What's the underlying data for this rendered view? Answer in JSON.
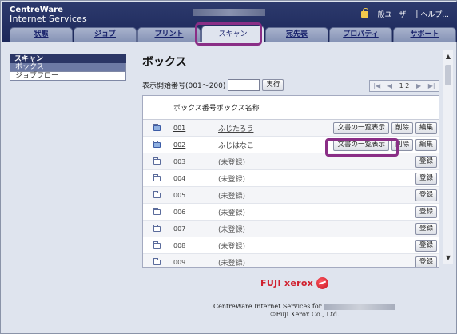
{
  "header": {
    "brand_line1": "CentreWare",
    "brand_line2": "Internet Services",
    "user_label": "一般ユーザー",
    "help_label": "ヘルプ..."
  },
  "tabs": [
    {
      "label": "状態"
    },
    {
      "label": "ジョブ"
    },
    {
      "label": "プリント"
    },
    {
      "label": "スキャン"
    },
    {
      "label": "宛先表"
    },
    {
      "label": "プロパティ"
    },
    {
      "label": "サポート"
    }
  ],
  "sidebar": {
    "title": "スキャン",
    "items": [
      {
        "label": "ボックス"
      },
      {
        "label": "ジョブフロー"
      }
    ]
  },
  "main": {
    "title": "ボックス",
    "filter_label": "表示開始番号(001～200)",
    "filter_value": "",
    "run_button": "実行",
    "pager_pages": "1 2"
  },
  "table": {
    "headers": [
      "ボックス番号",
      "ボックス名称"
    ],
    "rows": [
      {
        "num": "001",
        "name": "ふじたろう",
        "registered": true
      },
      {
        "num": "002",
        "name": "ふじはなこ",
        "registered": true
      },
      {
        "num": "003",
        "name": "(未登録)",
        "registered": false
      },
      {
        "num": "004",
        "name": "(未登録)",
        "registered": false
      },
      {
        "num": "005",
        "name": "(未登録)",
        "registered": false
      },
      {
        "num": "006",
        "name": "(未登録)",
        "registered": false
      },
      {
        "num": "007",
        "name": "(未登録)",
        "registered": false
      },
      {
        "num": "008",
        "name": "(未登録)",
        "registered": false
      },
      {
        "num": "009",
        "name": "(未登録)",
        "registered": false
      }
    ],
    "list_button": "文書の一覧表示",
    "delete_button": "削除",
    "edit_button": "編集",
    "register_button": "登録"
  },
  "footer": {
    "logo": "FUJI xerox",
    "line1": "CentreWare Internet Services for",
    "line2": "©Fuji Xerox Co., Ltd."
  },
  "colors": {
    "header_bg": "#1c285a",
    "highlight": "#8a2e86",
    "logo_red": "#d0202e"
  }
}
